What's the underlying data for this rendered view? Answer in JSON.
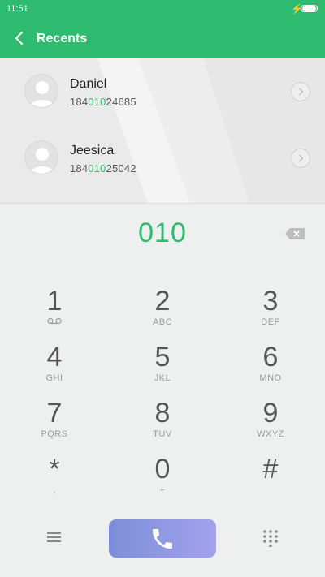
{
  "status_bar": {
    "time": "11:51",
    "battery_level": 1.0
  },
  "header": {
    "title": "Recents"
  },
  "recents": [
    {
      "name": "Daniel",
      "number_prefix": "184",
      "number_match": "010",
      "number_suffix": "24685"
    },
    {
      "name": "Jeesica",
      "number_prefix": "184",
      "number_match": "010",
      "number_suffix": "25042"
    }
  ],
  "dialpad": {
    "entry": "010",
    "keys": [
      {
        "digit": "1",
        "letters": ""
      },
      {
        "digit": "2",
        "letters": "ABC"
      },
      {
        "digit": "3",
        "letters": "DEF"
      },
      {
        "digit": "4",
        "letters": "GHI"
      },
      {
        "digit": "5",
        "letters": "JKL"
      },
      {
        "digit": "6",
        "letters": "MNO"
      },
      {
        "digit": "7",
        "letters": "PQRS"
      },
      {
        "digit": "8",
        "letters": "TUV"
      },
      {
        "digit": "9",
        "letters": "WXYZ"
      },
      {
        "digit": "*",
        "letters": ","
      },
      {
        "digit": "0",
        "letters": "+"
      },
      {
        "digit": "#",
        "letters": ""
      }
    ]
  },
  "colors": {
    "accent": "#2fbb6f",
    "call_button_start": "#7c8ed8",
    "call_button_end": "#a4a2ee"
  },
  "icons": {
    "back": "chevron-left-icon",
    "contact_detail": "chevron-right-icon",
    "backspace": "backspace-icon",
    "voicemail": "voicemail-icon",
    "menu": "menu-icon",
    "phone": "phone-icon",
    "dialpad_toggle": "dialpad-grid-icon"
  }
}
